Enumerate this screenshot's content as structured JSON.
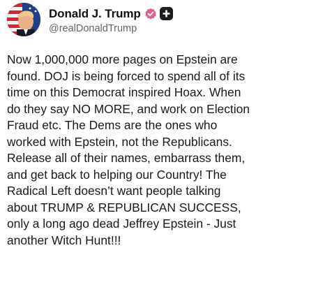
{
  "author": {
    "display_name": "Donald J. Trump",
    "handle": "@realDonaldTrump",
    "avatar_icon": "profile-avatar",
    "verified_icon": "verified-badge-icon",
    "verified_color": "#e35f8f",
    "plus_icon": "plus-badge-icon",
    "plus_color": "#1c1c22"
  },
  "post": {
    "text": "Now 1,000,000 more pages on Epstein are\nfound. DOJ is being forced to spend all of its\ntime on this Democrat inspired Hoax. When\ndo they say NO MORE, and work on Election\nFraud etc. The Dems are the ones who\nworked with Epstein, not the Republicans.\nRelease all of their names, embarrass them,\nand get back to helping our Country! The\nRadical Left doesn’t want people talking\nabout TRUMP & REPUBLICAN SUCCESS,\nonly a long ago dead Jeffrey Epstein - Just\nanother Witch Hunt!!!"
  }
}
